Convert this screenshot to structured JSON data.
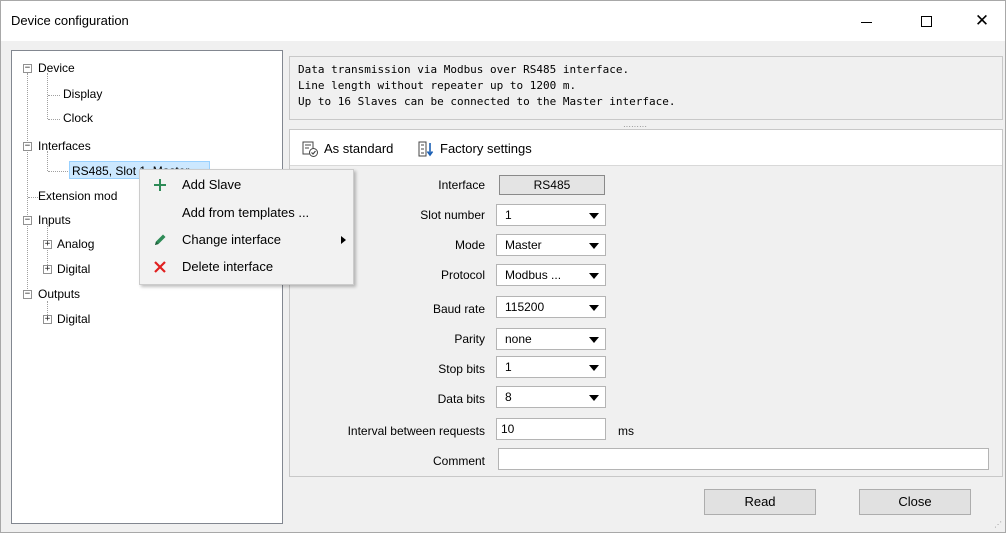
{
  "window": {
    "title": "Device configuration",
    "controls": {
      "minimize": "minimize-icon",
      "maximize": "maximize-icon",
      "close": "✕"
    }
  },
  "tree": {
    "device": "Device",
    "display": "Display",
    "clock": "Clock",
    "interfaces": "Interfaces",
    "rs485": "RS485, Slot 1, Master",
    "extension": "Extension mod",
    "inputs": "Inputs",
    "analog": "Analog",
    "digital_in": "Digital",
    "outputs": "Outputs",
    "digital_out": "Digital",
    "expander_minus": "−",
    "expander_plus": "+"
  },
  "context_menu": {
    "add_slave": "Add Slave",
    "add_templates": "Add from templates ...",
    "change_interface": "Change interface",
    "delete_interface": "Delete interface",
    "colors": {
      "add": "#2e8b57",
      "edit": "#2e8b57",
      "delete": "#e02020"
    }
  },
  "info": {
    "line1": "Data transmission via Modbus over RS485 interface.",
    "line2": "Line length without repeater up to 1200 m.",
    "line3": "Up to 16 Slaves can be connected to the Master interface.",
    "grip": "·········"
  },
  "toolbar": {
    "as_standard": "As standard",
    "factory_settings": "Factory settings"
  },
  "form": {
    "interface_label": "Interface",
    "interface_value": "RS485",
    "slot_label": "Slot number",
    "slot_value": "1",
    "mode_label": "Mode",
    "mode_value": "Master",
    "protocol_label": "Protocol",
    "protocol_value": "Modbus ...",
    "baud_label": "Baud rate",
    "baud_value": "115200",
    "parity_label": "Parity",
    "parity_value": "none",
    "stopbits_label": "Stop bits",
    "stopbits_value": "1",
    "databits_label": "Data bits",
    "databits_value": "8",
    "interval_label": "Interval between requests",
    "interval_value": "10",
    "interval_unit": "ms",
    "comment_label": "Comment",
    "comment_value": ""
  },
  "buttons": {
    "read": "Read",
    "close": "Close"
  }
}
